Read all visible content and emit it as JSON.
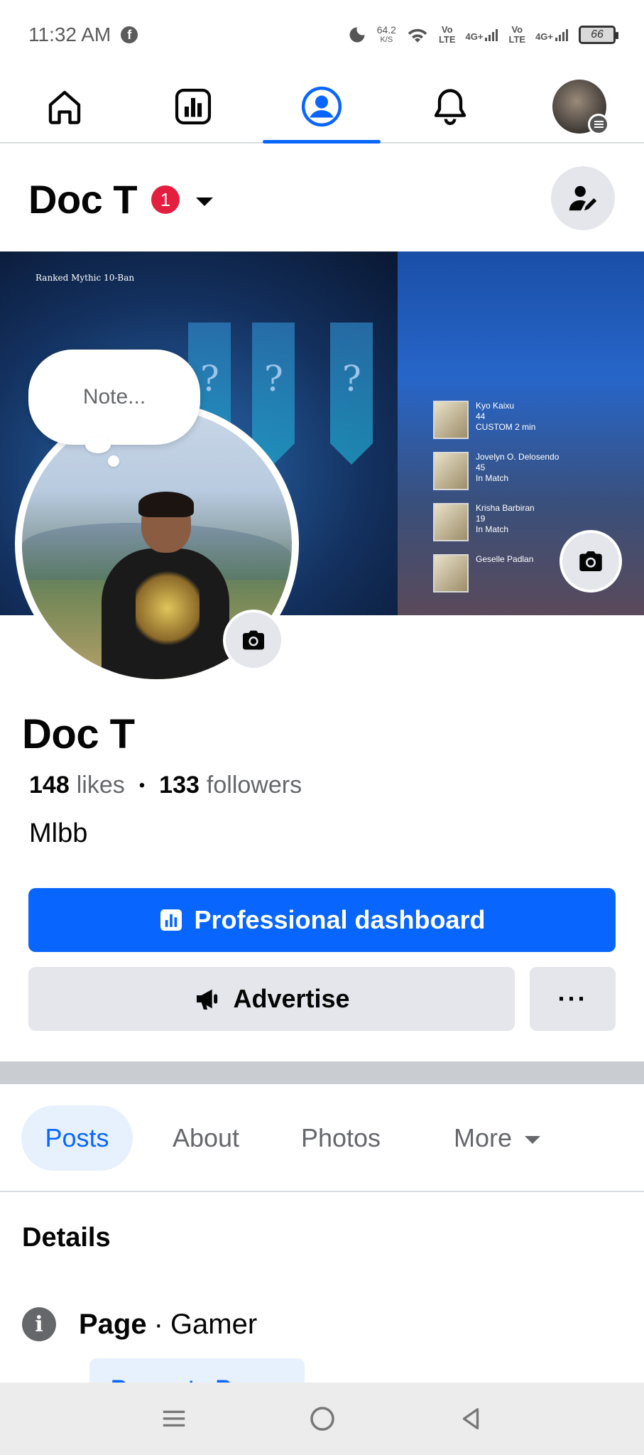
{
  "status_bar": {
    "time": "11:32 AM",
    "fb_icon": "f",
    "speed_value": "64.2",
    "speed_unit": "K/S",
    "sim1_label": "Vo\nLTE",
    "sim1_net": "4G+",
    "sim2_label": "Vo\nLTE",
    "sim2_net": "4G+",
    "battery": "66"
  },
  "topnav": {
    "items": [
      {
        "name": "home",
        "icon": "home-icon"
      },
      {
        "name": "dashboard",
        "icon": "chart-icon"
      },
      {
        "name": "profile",
        "icon": "profile-icon",
        "active": true
      },
      {
        "name": "notifications",
        "icon": "bell-icon"
      },
      {
        "name": "menu",
        "icon": "avatar"
      }
    ]
  },
  "header": {
    "title": "Doc T",
    "badge_count": "1"
  },
  "cover": {
    "topbar_text": "Ranked Mythic 10-Ban",
    "players": [
      {
        "name": "Kyo Kaixu",
        "stat": "44",
        "status": "CUSTOM 2 min"
      },
      {
        "name": "Jovelyn O. Delosendo",
        "stat": "45",
        "status": "In Match"
      },
      {
        "name": "Krisha Barbiran",
        "stat": "19",
        "status": "In Match"
      },
      {
        "name": "Geselle Padlan",
        "stat": "",
        "status": ""
      }
    ]
  },
  "note": {
    "placeholder": "Note..."
  },
  "profile": {
    "name": "Doc T",
    "likes_count": "148",
    "likes_label": "likes",
    "followers_count": "133",
    "followers_label": "followers",
    "bio": "Mlbb"
  },
  "actions": {
    "dashboard_label": "Professional dashboard",
    "advertise_label": "Advertise",
    "more_label": "···"
  },
  "tabs": [
    {
      "label": "Posts",
      "active": true
    },
    {
      "label": "About"
    },
    {
      "label": "Photos"
    },
    {
      "label": "More"
    }
  ],
  "details": {
    "title": "Details",
    "page_label": "Page",
    "separator": "·",
    "category": "Gamer",
    "promote_label": "Promote Page"
  },
  "colors": {
    "accent": "#0866ff",
    "badge": "#e41e3f",
    "button_gray": "#e4e6eb",
    "text_secondary": "#65676b"
  }
}
